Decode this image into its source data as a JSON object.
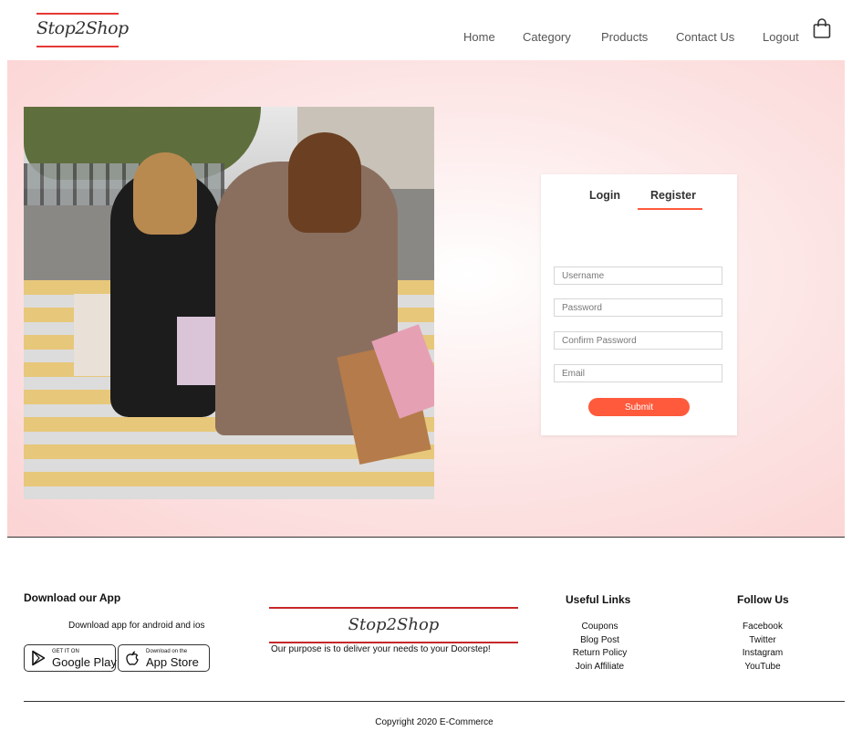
{
  "header": {
    "logo_text": "Stop2Shop",
    "nav": [
      "Home",
      "Category",
      "Products",
      "Contact Us",
      "Logout"
    ],
    "cart_icon": "shopping-bag-icon"
  },
  "hero": {
    "image_alt": "shopping-women-photo"
  },
  "auth_form": {
    "tabs": [
      "Login",
      "Register"
    ],
    "active_tab": "Register",
    "fields": {
      "username_placeholder": "Username",
      "password_placeholder": "Password",
      "confirm_password_placeholder": "Confirm Password",
      "email_placeholder": "Email"
    },
    "submit_label": "Submit"
  },
  "footer": {
    "download": {
      "heading": "Download our App",
      "text": "Download app for android and ios",
      "google_play": {
        "small": "GET IT ON",
        "big": "Google Play"
      },
      "app_store": {
        "small": "Download on the",
        "big": "App Store"
      }
    },
    "brand": {
      "logo_text": "Stop2Shop",
      "tagline": "Our purpose is to deliver your needs to your Doorstep!"
    },
    "useful_links": {
      "heading": "Useful Links",
      "items": [
        "Coupons",
        "Blog Post",
        "Return Policy",
        "Join Affiliate"
      ]
    },
    "follow_us": {
      "heading": "Follow Us",
      "items": [
        "Facebook",
        "Twitter",
        "Instagram",
        "YouTube"
      ]
    },
    "copyright": "Copyright 2020 E-Commerce"
  },
  "colors": {
    "accent": "#ff5a3c",
    "logo_red": "#e53935",
    "hero_pink": "#fbd3d3"
  }
}
